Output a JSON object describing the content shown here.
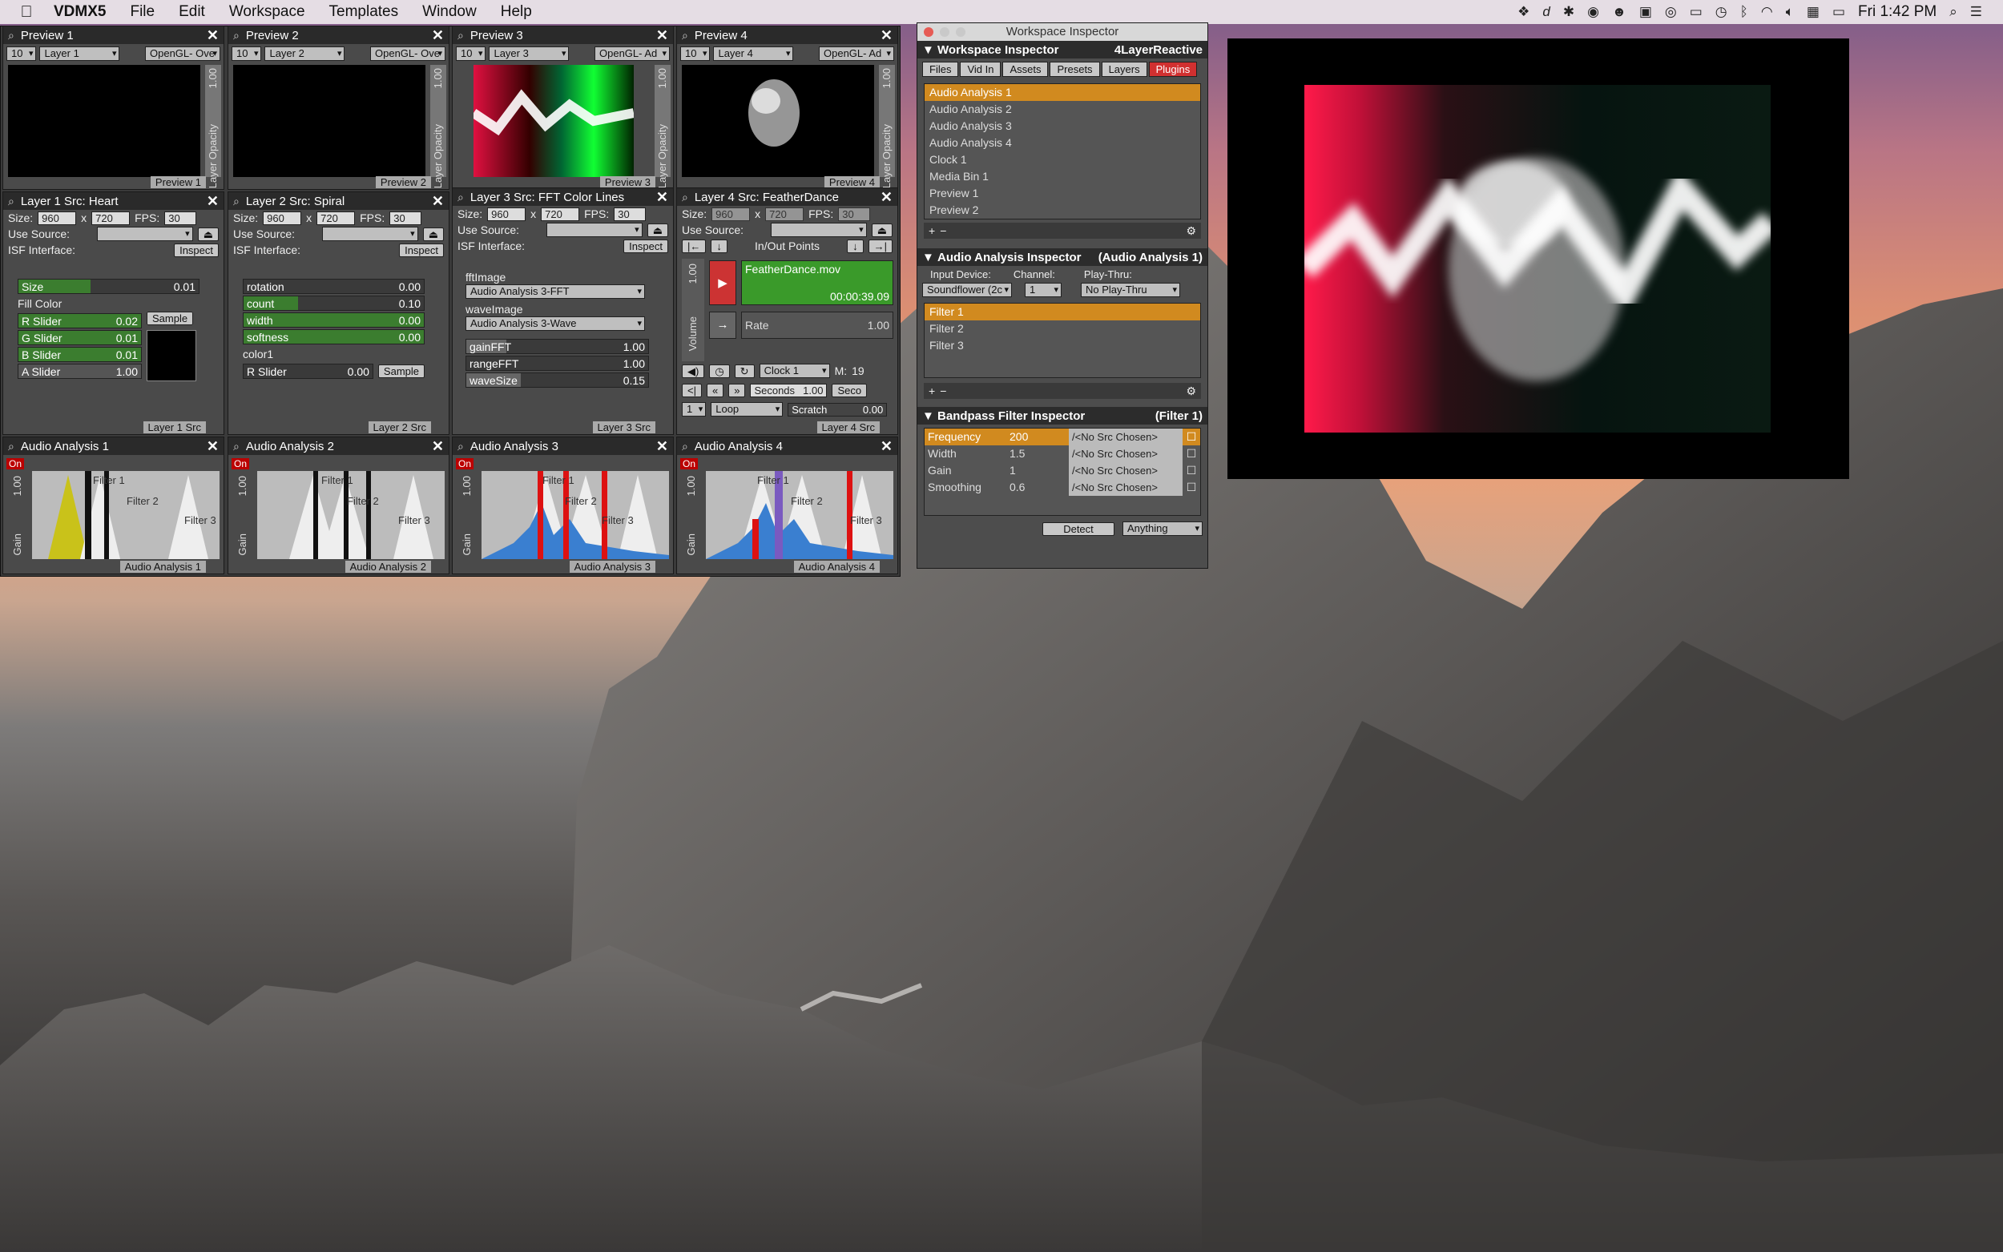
{
  "menubar": {
    "app": "VDMX5",
    "items": [
      "File",
      "Edit",
      "Workspace",
      "Templates",
      "Window",
      "Help"
    ],
    "clock": "Fri 1:42 PM"
  },
  "previews": [
    {
      "title": "Preview 1",
      "res": "10",
      "layer": "Layer 1",
      "mode": "OpenGL- Ove",
      "opacity_label": "Layer Opacity",
      "opacity": "1.00",
      "footer": "Preview 1"
    },
    {
      "title": "Preview 2",
      "res": "10",
      "layer": "Layer 2",
      "mode": "OpenGL- Ove",
      "opacity_label": "Layer Opacity",
      "opacity": "1.00",
      "footer": "Preview 2"
    },
    {
      "title": "Preview 3",
      "res": "10",
      "layer": "Layer 3",
      "mode": "OpenGL- Ad",
      "opacity_label": "Layer Opacity",
      "opacity": "1.00",
      "footer": "Preview 3"
    },
    {
      "title": "Preview 4",
      "res": "10",
      "layer": "Layer 4",
      "mode": "OpenGL- Ad",
      "opacity_label": "Layer Opacity",
      "opacity": "1.00",
      "footer": "Preview 4"
    }
  ],
  "layer1": {
    "title": "Layer 1 Src: Heart",
    "size_label": "Size:",
    "w": "960",
    "x": "x",
    "h": "720",
    "fps_label": "FPS:",
    "fps": "30",
    "use_source": "Use Source:",
    "isf": "ISF Interface:",
    "inspect": "Inspect",
    "footer": "Layer 1 Src",
    "size_slider": {
      "label": "Size",
      "value": "0.01"
    },
    "fill_color": "Fill Color",
    "sliders": [
      {
        "label": "R Slider",
        "value": "0.02"
      },
      {
        "label": "G Slider",
        "value": "0.01"
      },
      {
        "label": "B Slider",
        "value": "0.01"
      },
      {
        "label": "A Slider",
        "value": "1.00"
      }
    ],
    "sample": "Sample"
  },
  "layer2": {
    "title": "Layer 2 Src: Spiral",
    "size_label": "Size:",
    "w": "960",
    "x": "x",
    "h": "720",
    "fps_label": "FPS:",
    "fps": "30",
    "use_source": "Use Source:",
    "isf": "ISF Interface:",
    "inspect": "Inspect",
    "footer": "Layer 2 Src",
    "sliders": [
      {
        "label": "rotation",
        "value": "0.00"
      },
      {
        "label": "count",
        "value": "0.10"
      },
      {
        "label": "width",
        "value": "0.00"
      },
      {
        "label": "softness",
        "value": "0.00"
      }
    ],
    "color1": "color1",
    "rslider": {
      "label": "R Slider",
      "value": "0.00"
    },
    "sample": "Sample"
  },
  "layer3": {
    "title": "Layer 3 Src: FFT Color Lines",
    "size_label": "Size:",
    "w": "960",
    "x": "x",
    "h": "720",
    "fps_label": "FPS:",
    "fps": "30",
    "use_source": "Use Source:",
    "isf": "ISF Interface:",
    "inspect": "Inspect",
    "footer": "Layer 3 Src",
    "fft_label": "fftImage",
    "fft_sel": "Audio Analysis 3-FFT",
    "wave_label": "waveImage",
    "wave_sel": "Audio Analysis 3-Wave",
    "sliders": [
      {
        "label": "gainFFT",
        "value": "1.00"
      },
      {
        "label": "rangeFFT",
        "value": "1.00"
      },
      {
        "label": "waveSize",
        "value": "0.15"
      }
    ]
  },
  "layer4": {
    "title": "Layer 4 Src: FeatherDance",
    "size_label": "Size:",
    "w": "960",
    "x": "x",
    "h": "720",
    "fps_label": "FPS:",
    "fps": "30",
    "use_source": "Use Source:",
    "inout": "In/Out Points",
    "file": "FeatherDance.mov",
    "time": "00:00:39.09",
    "rate_label": "Rate",
    "rate": "1.00",
    "volume": "Volume",
    "vol": "1.00",
    "clock": "Clock 1",
    "m_label": "M:",
    "m": "19",
    "seconds": "Seconds",
    "sec_val": "1.00",
    "sec_short": "Seco",
    "loop": "Loop",
    "loop_num": "1",
    "scratch": "Scratch",
    "scratch_val": "0.00",
    "footer": "Layer 4 Src"
  },
  "audio": [
    {
      "title": "Audio Analysis 1",
      "on": "On",
      "gain": "Gain",
      "val": "1.00",
      "f1": "Filter 1",
      "f2": "Filter 2",
      "f3": "Filter 3",
      "footer": "Audio Analysis 1"
    },
    {
      "title": "Audio Analysis 2",
      "on": "On",
      "gain": "Gain",
      "val": "1.00",
      "f1": "Filter 1",
      "f2": "Filter 2",
      "f3": "Filter 3",
      "footer": "Audio Analysis 2"
    },
    {
      "title": "Audio Analysis 3",
      "on": "On",
      "gain": "Gain",
      "val": "1.00",
      "f1": "Filter 1",
      "f2": "Filter 2",
      "f3": "Filter 3",
      "footer": "Audio Analysis 3"
    },
    {
      "title": "Audio Analysis 4",
      "on": "On",
      "gain": "Gain",
      "val": "1.00",
      "f1": "Filter 1",
      "f2": "Filter 2",
      "f3": "Filter 3",
      "footer": "Audio Analysis 4"
    }
  ],
  "inspector": {
    "window_title": "Workspace Inspector",
    "header": "Workspace Inspector",
    "project": "4LayerReactive",
    "tabs": [
      "Files",
      "Vid In",
      "Assets",
      "Presets",
      "Layers",
      "Plugins"
    ],
    "plugins": [
      "Audio Analysis 1",
      "Audio Analysis 2",
      "Audio Analysis 3",
      "Audio Analysis 4",
      "Clock 1",
      "Media Bin 1",
      "Preview 1",
      "Preview 2"
    ],
    "aai_header": "Audio Analysis Inspector",
    "aai_sub": "(Audio Analysis 1)",
    "input_device": "Input Device:",
    "device": "Soundflower (2c",
    "channel": "Channel:",
    "ch": "1",
    "playthru": "Play-Thru:",
    "pt": "No Play-Thru",
    "filters": [
      "Filter 1",
      "Filter 2",
      "Filter 3"
    ],
    "bp_header": "Bandpass Filter Inspector",
    "bp_sub": "(Filter 1)",
    "params": [
      {
        "name": "Frequency",
        "value": "200",
        "src": "/<No Src Chosen>"
      },
      {
        "name": "Width",
        "value": "1.5",
        "src": "/<No Src Chosen>"
      },
      {
        "name": "Gain",
        "value": "1",
        "src": "/<No Src Chosen>"
      },
      {
        "name": "Smoothing",
        "value": "0.6",
        "src": "/<No Src Chosen>"
      }
    ],
    "detect": "Detect",
    "anything": "Anything"
  },
  "colors": {
    "accent": "#d18a1f",
    "slider_fill": "#3b7d2f",
    "on_red": "#bb0000"
  }
}
